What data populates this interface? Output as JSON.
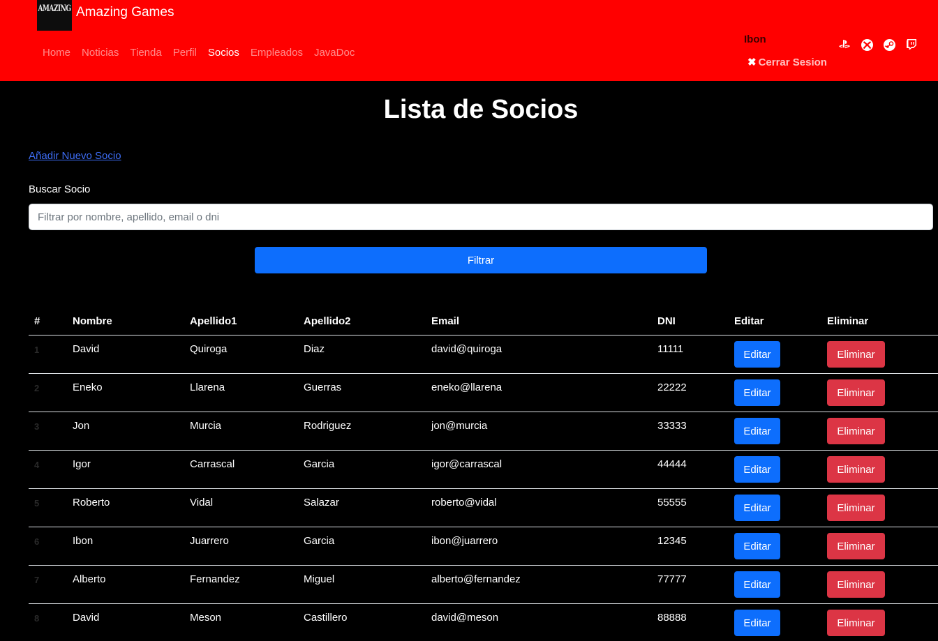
{
  "header": {
    "logo_text": "AMAZING",
    "brand": "Amazing Games",
    "nav": [
      {
        "label": "Home",
        "active": false
      },
      {
        "label": "Noticias",
        "active": false
      },
      {
        "label": "Tienda",
        "active": false
      },
      {
        "label": "Perfil",
        "active": false
      },
      {
        "label": "Socios",
        "active": true
      },
      {
        "label": "Empleados",
        "active": false
      },
      {
        "label": "JavaDoc",
        "active": false
      }
    ],
    "user": "Ibon",
    "logout_icon": "x-icon",
    "logout_label": "Cerrar Sesion",
    "socials": [
      "playstation-icon",
      "xbox-icon",
      "steam-icon",
      "twitch-icon"
    ],
    "bg_color": "#ff0000"
  },
  "main": {
    "title": "Lista de Socios",
    "add_link": "Añadir Nuevo Socio",
    "search_label": "Buscar Socio",
    "search_placeholder": "Filtrar por nombre, apellido, email o dni",
    "search_value": "",
    "filter_button": "Filtrar"
  },
  "table": {
    "headers": [
      "#",
      "Nombre",
      "Apellido1",
      "Apellido2",
      "Email",
      "DNI",
      "Editar",
      "Eliminar"
    ],
    "edit_label": "Editar",
    "delete_label": "Eliminar",
    "rows": [
      {
        "n": "1",
        "nombre": "David",
        "apellido1": "Quiroga",
        "apellido2": "Diaz",
        "email": "david@quiroga",
        "dni": "11111"
      },
      {
        "n": "2",
        "nombre": "Eneko",
        "apellido1": "Llarena",
        "apellido2": "Guerras",
        "email": "eneko@llarena",
        "dni": "22222"
      },
      {
        "n": "3",
        "nombre": "Jon",
        "apellido1": "Murcia",
        "apellido2": "Rodriguez",
        "email": "jon@murcia",
        "dni": "33333"
      },
      {
        "n": "4",
        "nombre": "Igor",
        "apellido1": "Carrascal",
        "apellido2": "Garcia",
        "email": "igor@carrascal",
        "dni": "44444"
      },
      {
        "n": "5",
        "nombre": "Roberto",
        "apellido1": "Vidal",
        "apellido2": "Salazar",
        "email": "roberto@vidal",
        "dni": "55555"
      },
      {
        "n": "6",
        "nombre": "Ibon",
        "apellido1": "Juarrero",
        "apellido2": "Garcia",
        "email": "ibon@juarrero",
        "dni": "12345"
      },
      {
        "n": "7",
        "nombre": "Alberto",
        "apellido1": "Fernandez",
        "apellido2": "Miguel",
        "email": "alberto@fernandez",
        "dni": "77777"
      },
      {
        "n": "8",
        "nombre": "David",
        "apellido1": "Meson",
        "apellido2": "Castillero",
        "email": "david@meson",
        "dni": "88888"
      }
    ],
    "colors": {
      "edit": "#0d6efd",
      "delete": "#dc3545"
    }
  }
}
